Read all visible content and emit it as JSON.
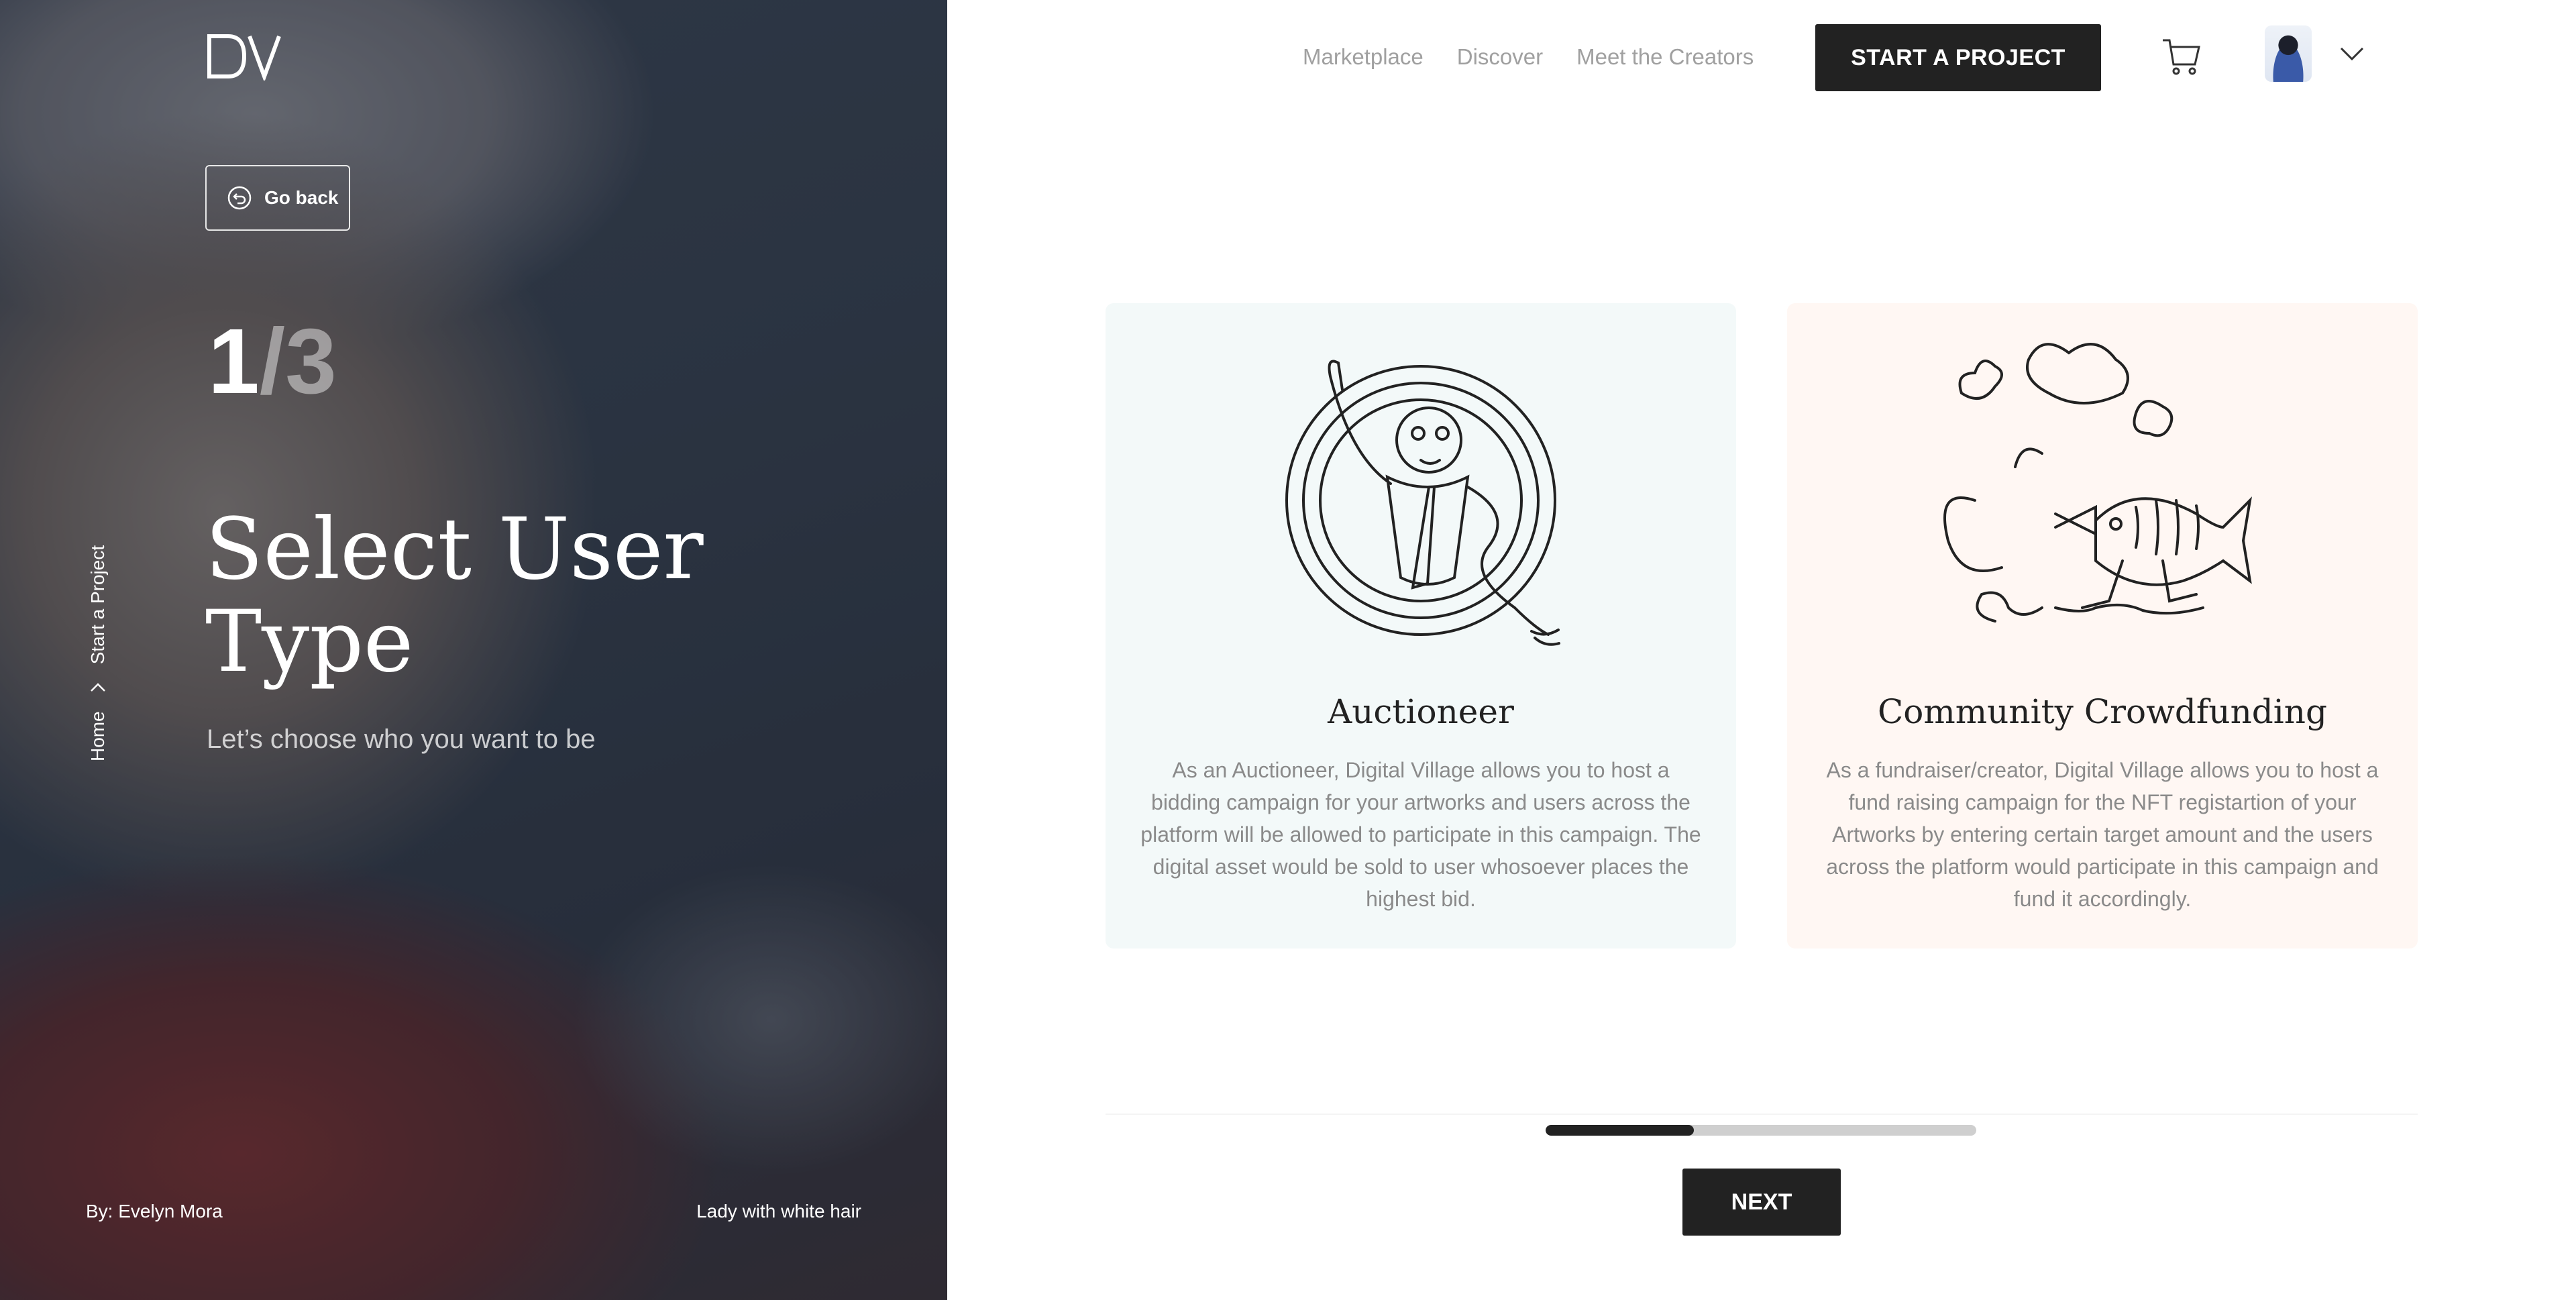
{
  "brand": {
    "logo_text": "DV"
  },
  "left_panel": {
    "go_back_label": "Go back",
    "step_current": "1",
    "step_total": "/3",
    "title": "Select User Type",
    "subtitle": "Let’s choose who you want to be",
    "breadcrumb": {
      "home": "Home",
      "current": "Start a Project"
    },
    "credit_author": "By: Evelyn Mora",
    "credit_title": "Lady with white hair"
  },
  "header": {
    "nav": [
      "Marketplace",
      "Discover",
      "Meet the Creators"
    ],
    "cta_label": "START A PROJECT",
    "cart_icon": "cart-icon",
    "dropdown_icon": "chevron-down-icon"
  },
  "cards": [
    {
      "title": "Auctioneer",
      "description": "As an Auctioneer, Digital Village allows you to host a bidding campaign for your artworks and users across the platform will be allowed to participate in this campaign. The digital asset would be sold to user whosoever places the highest bid.",
      "bg": "#f3f9f9"
    },
    {
      "title": "Community Crowdfunding",
      "description": "As a fundraiser/creator, Digital Village allows you to host a fund raising campaign for the NFT registartion of your Artworks by entering certain target amount and the users across the platform would participate in this campaign and fund it accordingly.",
      "bg": "#fff7f3"
    }
  ],
  "progress": {
    "fraction": 0.345
  },
  "next_label": "NEXT",
  "colors": {
    "accent": "#222222",
    "nav_text": "#a0a0a0"
  }
}
